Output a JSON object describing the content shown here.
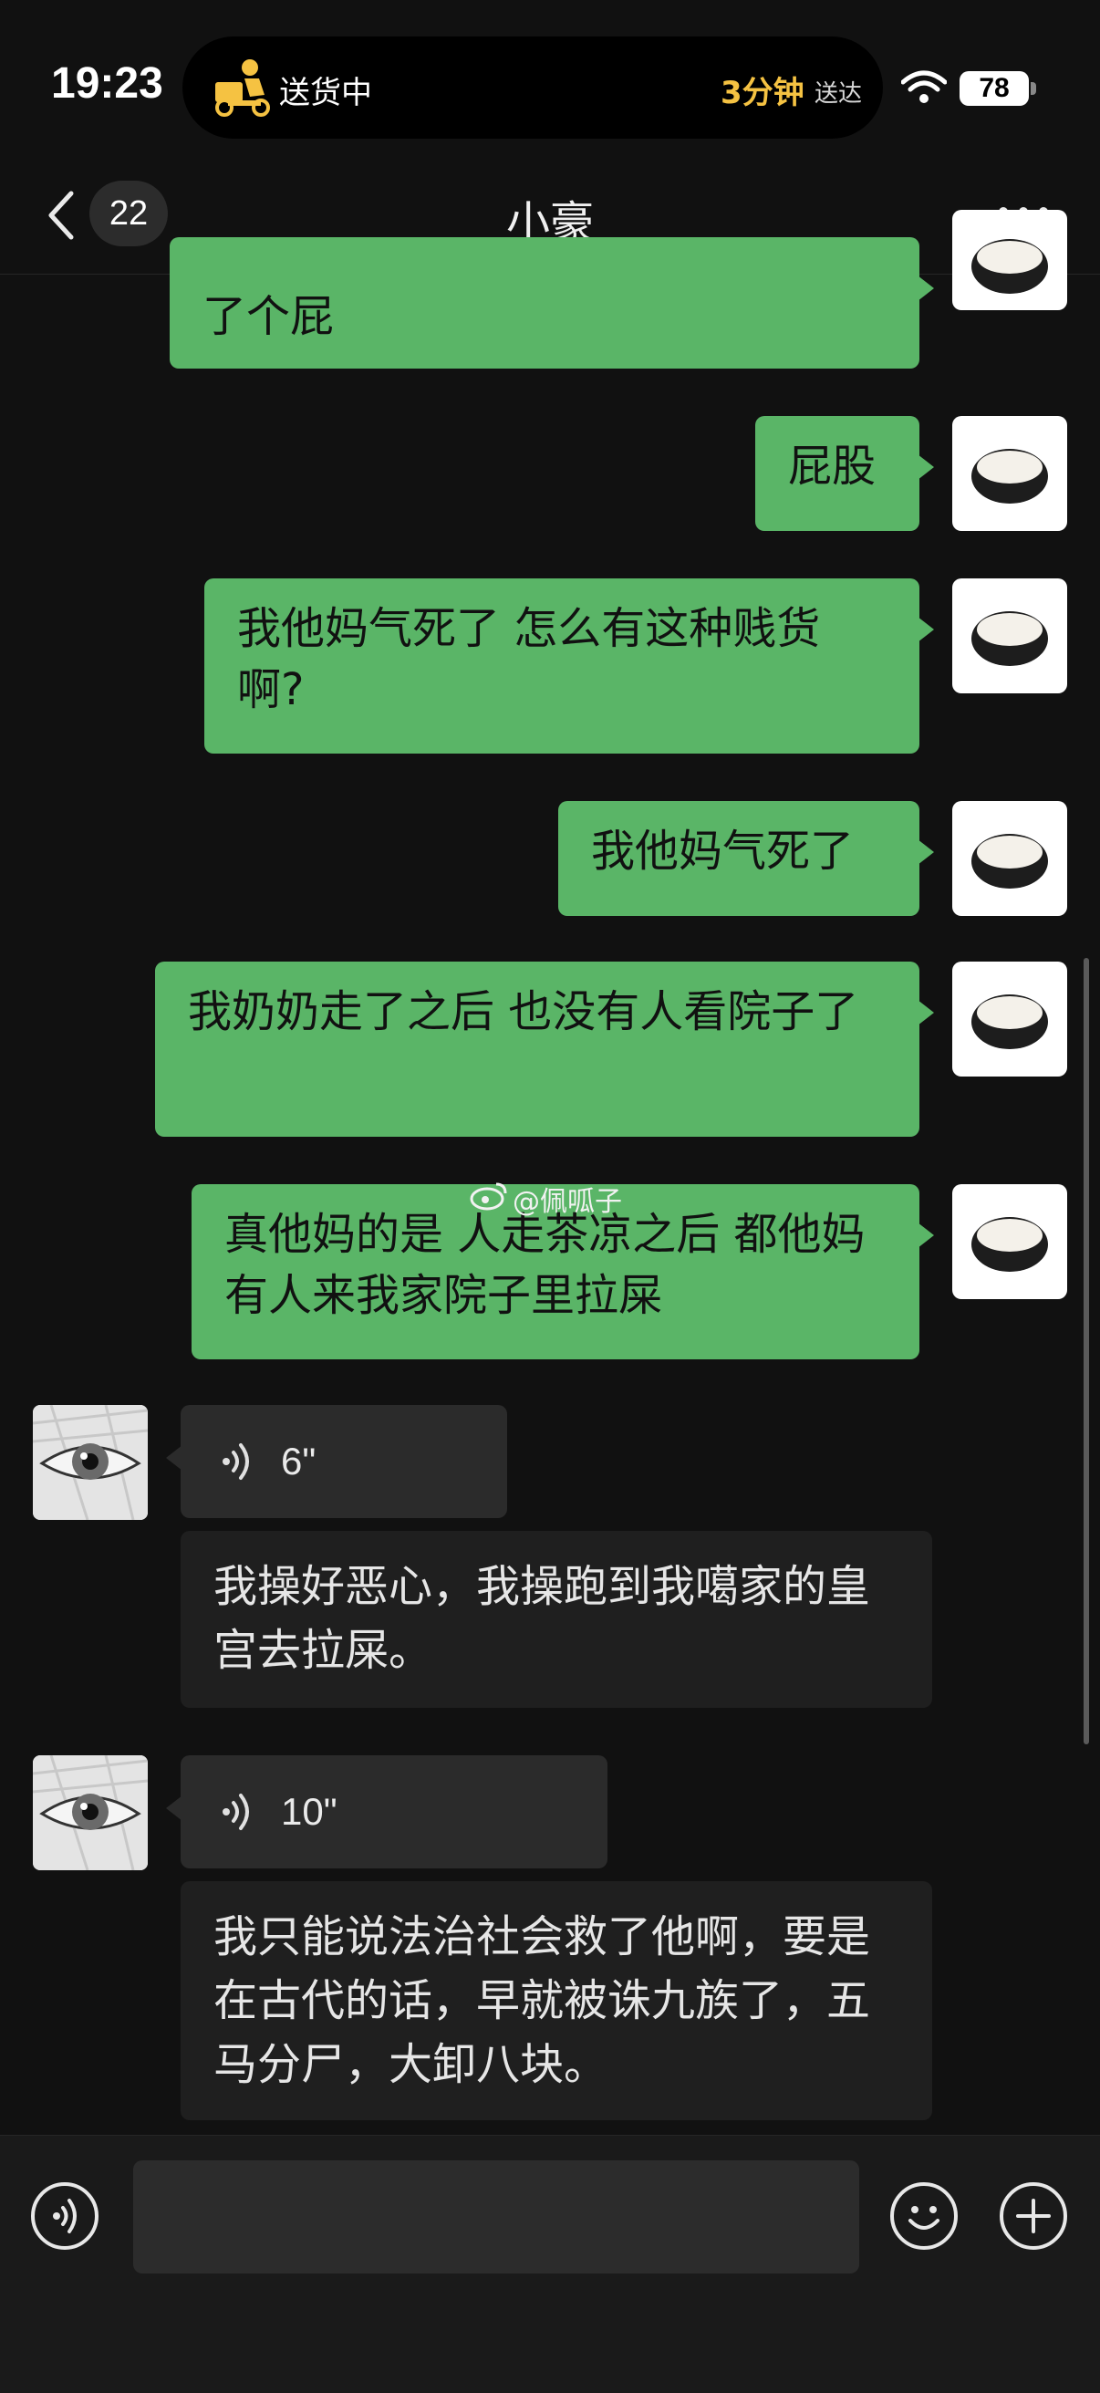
{
  "status_bar": {
    "time": "19:23",
    "activity_label": "送货中",
    "eta_value": "3分钟",
    "eta_suffix": "送达",
    "battery": "78",
    "icons": [
      "delivery-rider-icon",
      "wifi-icon",
      "battery-icon"
    ]
  },
  "nav": {
    "back_badge": "22",
    "title": "小豪",
    "icons": [
      "chevron-left-icon",
      "more-icon"
    ]
  },
  "messages": [
    {
      "side": "out",
      "text": "了个屁"
    },
    {
      "side": "out",
      "text": "屁股"
    },
    {
      "side": "out",
      "text": "我他妈气死了 怎么有这种贱货啊?"
    },
    {
      "side": "out",
      "text": "我他妈气死了"
    },
    {
      "side": "out",
      "text": "我奶奶走了之后 也没有人看院子了"
    },
    {
      "side": "out",
      "text": "真他妈的是 人走茶凉之后 都他妈有人来我家院子里拉屎"
    },
    {
      "side": "in",
      "voice": "6\"",
      "transcript": "我操好恶心，我操跑到我噶家的皇宫去拉屎。"
    },
    {
      "side": "in",
      "voice": "10\"",
      "transcript": "我只能说法治社会救了他啊，要是在古代的话，早就被诛九族了，五马分尸，大卸八块。"
    }
  ],
  "watermark": "@佩呱子",
  "input_bar": {
    "icons": [
      "voice-input-icon",
      "emoji-icon",
      "plus-icon"
    ]
  }
}
